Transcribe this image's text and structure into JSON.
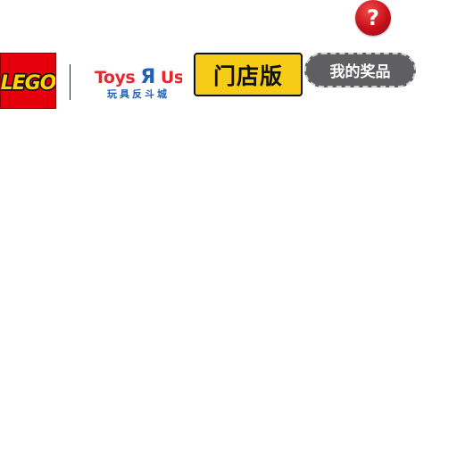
{
  "header": {
    "help_button_label": "?",
    "lego_logo_text": "LEGO",
    "partner_logo": {
      "brand_parts": [
        "Toys",
        "Я",
        "Us"
      ],
      "subtitle": "玩具反斗城"
    },
    "store_edition_label": "门店版",
    "my_prizes_label": "我的奖品"
  },
  "colors": {
    "lego_red": "#e3000b",
    "lego_yellow": "#ffd400",
    "tag_yellow": "#f7cc17",
    "help_red": "#c8101a",
    "prizes_gray": "#5f5f61",
    "toys_red": "#e8262e",
    "toys_blue": "#1f5fb5",
    "toys_green": "#39a935",
    "toys_orange": "#f39200"
  }
}
